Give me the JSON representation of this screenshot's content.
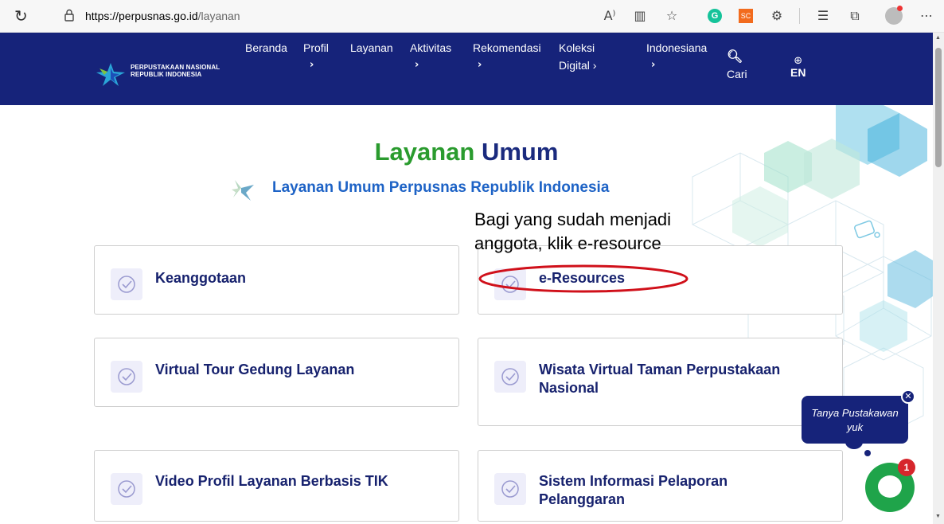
{
  "browser": {
    "url_host": "https://perpusnas.go.id",
    "url_path": "/layanan",
    "read_aloud_label": "A⁾"
  },
  "nav": {
    "logo_line1": "PERPUSTAKAAN NASIONAL",
    "logo_line2": "REPUBLIK INDONESIA",
    "items": [
      {
        "label": "Beranda",
        "chevron": ""
      },
      {
        "label": "Profil",
        "chevron": "›"
      },
      {
        "label": "Layanan",
        "chevron": ""
      },
      {
        "label": "Aktivitas",
        "chevron": "›"
      },
      {
        "label": "Rekomendasi",
        "chevron": "›"
      },
      {
        "label": "Koleksi",
        "chevron": "Digital ›"
      },
      {
        "label": "Indonesiana",
        "chevron": "›"
      }
    ],
    "search_label": "Cari",
    "lang_label": "EN"
  },
  "page": {
    "title_green": "Layanan",
    "title_blue": "Umum",
    "subtitle": "Layanan Umum Perpusnas Republik Indonesia"
  },
  "annotation": {
    "line1": "Bagi yang sudah menjadi",
    "line2": "anggota, klik e-resource",
    "color": "#d0101a"
  },
  "cards": [
    {
      "title": "Keanggotaan"
    },
    {
      "title": "e-Resources"
    },
    {
      "title": "Virtual Tour Gedung Layanan"
    },
    {
      "title": "Wisata Virtual Taman Perpustakaan Nasional"
    },
    {
      "title": "Video Profil Layanan Berbasis TIK"
    },
    {
      "title": "Sistem Informasi Pelaporan Pelanggaran"
    }
  ],
  "chat": {
    "bubble_line1": "Tanya Pustakawan",
    "bubble_line2": "yuk",
    "badge_count": "1"
  },
  "colors": {
    "nav_bg": "#16237a",
    "title_green": "#2a9b2e",
    "title_blue": "#1a2a7e",
    "subtitle_blue": "#1e63c6",
    "chat_green": "#1fa44a"
  }
}
